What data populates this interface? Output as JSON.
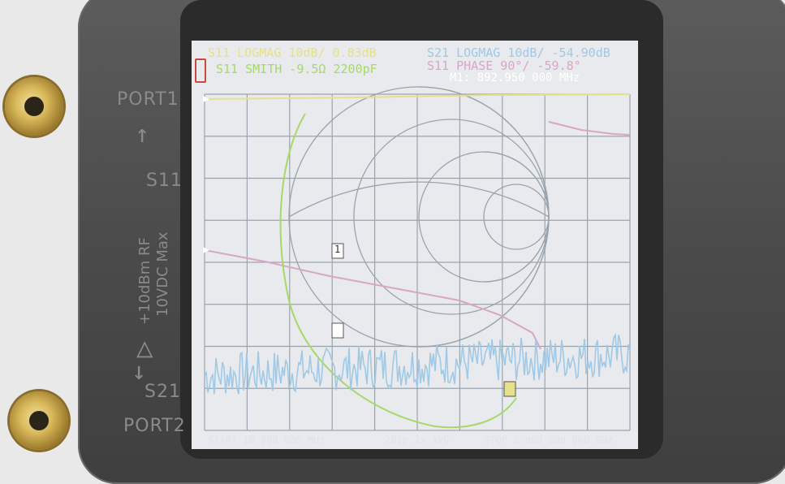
{
  "device": {
    "port1_label": "PORT1",
    "port2_label": "PORT2",
    "s11_label": "S11",
    "s21_label": "S21",
    "rating_line1": "+10dBm RF",
    "rating_line2": "10VDC Max"
  },
  "screen": {
    "trace_s11_logmag": "S11 LOGMAG 10dB/ 0.83dB",
    "trace_s11_smith": "S11 SMITH  -9.5Ω 2200pF",
    "trace_s21_logmag": "S21 LOGMAG 10dB/ -54.90dB",
    "trace_s11_phase": "S11 PHASE 90°/ -59.8°",
    "marker_readout": "M1: 892.950 000 MHz",
    "marker_label": "1",
    "footer_start": "START  10.000 000 MHz",
    "footer_points": "201p  2x AVG",
    "footer_stop": "STOP 3.000 000 000 GHz",
    "colors": {
      "s11_logmag": "#e6e08a",
      "s11_smith": "#a8d86a",
      "s21_logmag": "#9fc9e6",
      "s11_phase": "#d9a6c6",
      "grid": "#9aa3ad"
    }
  }
}
